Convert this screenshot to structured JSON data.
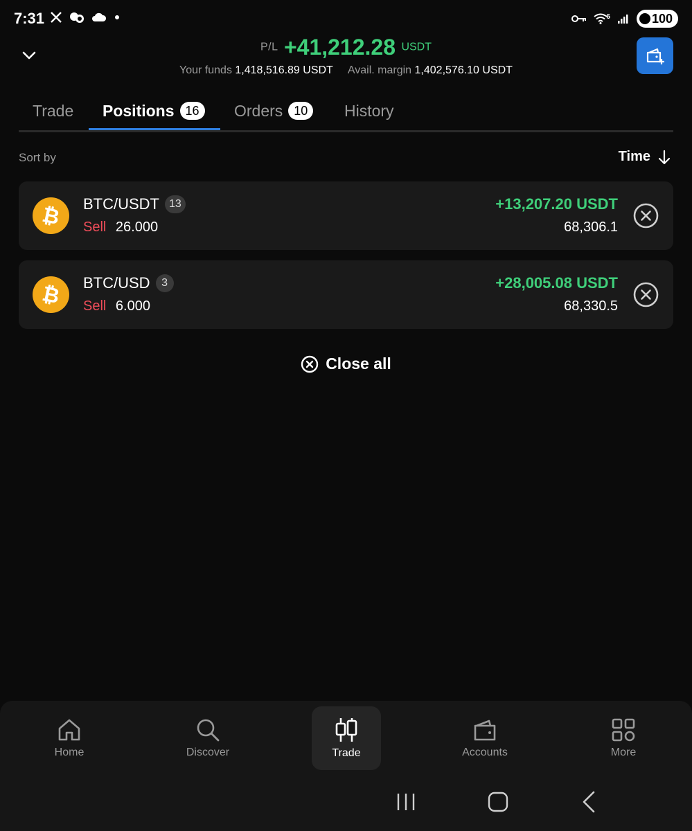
{
  "status_bar": {
    "time": "7:31",
    "left_icons": [
      "x-icon",
      "messenger-icon",
      "cloud-icon",
      "dot-icon"
    ],
    "right_icons": [
      "vpn-key-icon",
      "wifi-icon",
      "signal-icon"
    ],
    "wifi_badge": "6",
    "battery": "100"
  },
  "header": {
    "pl_label": "P/L",
    "pl_value": "+41,212.28",
    "pl_unit": "USDT",
    "funds_label": "Your funds",
    "funds_value": "1,418,516.89 USDT",
    "margin_label": "Avail. margin",
    "margin_value": "1,402,576.10 USDT"
  },
  "tabs": [
    {
      "label": "Trade",
      "badge": null
    },
    {
      "label": "Positions",
      "badge": "16",
      "active": true
    },
    {
      "label": "Orders",
      "badge": "10"
    },
    {
      "label": "History",
      "badge": null
    }
  ],
  "sort": {
    "label": "Sort by",
    "value": "Time"
  },
  "positions": [
    {
      "pair": "BTC/USDT",
      "count": "13",
      "side": "Sell",
      "quantity": "26.000",
      "pnl": "+13,207.20 USDT",
      "price": "68,306.1"
    },
    {
      "pair": "BTC/USD",
      "count": "3",
      "side": "Sell",
      "quantity": "6.000",
      "pnl": "+28,005.08 USDT",
      "price": "68,330.5"
    }
  ],
  "close_all_label": "Close all",
  "bottom_nav": [
    {
      "label": "Home",
      "icon": "home-icon"
    },
    {
      "label": "Discover",
      "icon": "search-icon"
    },
    {
      "label": "Trade",
      "icon": "candlestick-icon",
      "active": true
    },
    {
      "label": "Accounts",
      "icon": "wallet-icon"
    },
    {
      "label": "More",
      "icon": "grid-icon"
    }
  ],
  "colors": {
    "background": "#0b0b0b",
    "card": "#1a1a1a",
    "profit": "#3fcf7a",
    "sell": "#f04d5a",
    "accent": "#2475d8",
    "coin": "#f2a818"
  }
}
